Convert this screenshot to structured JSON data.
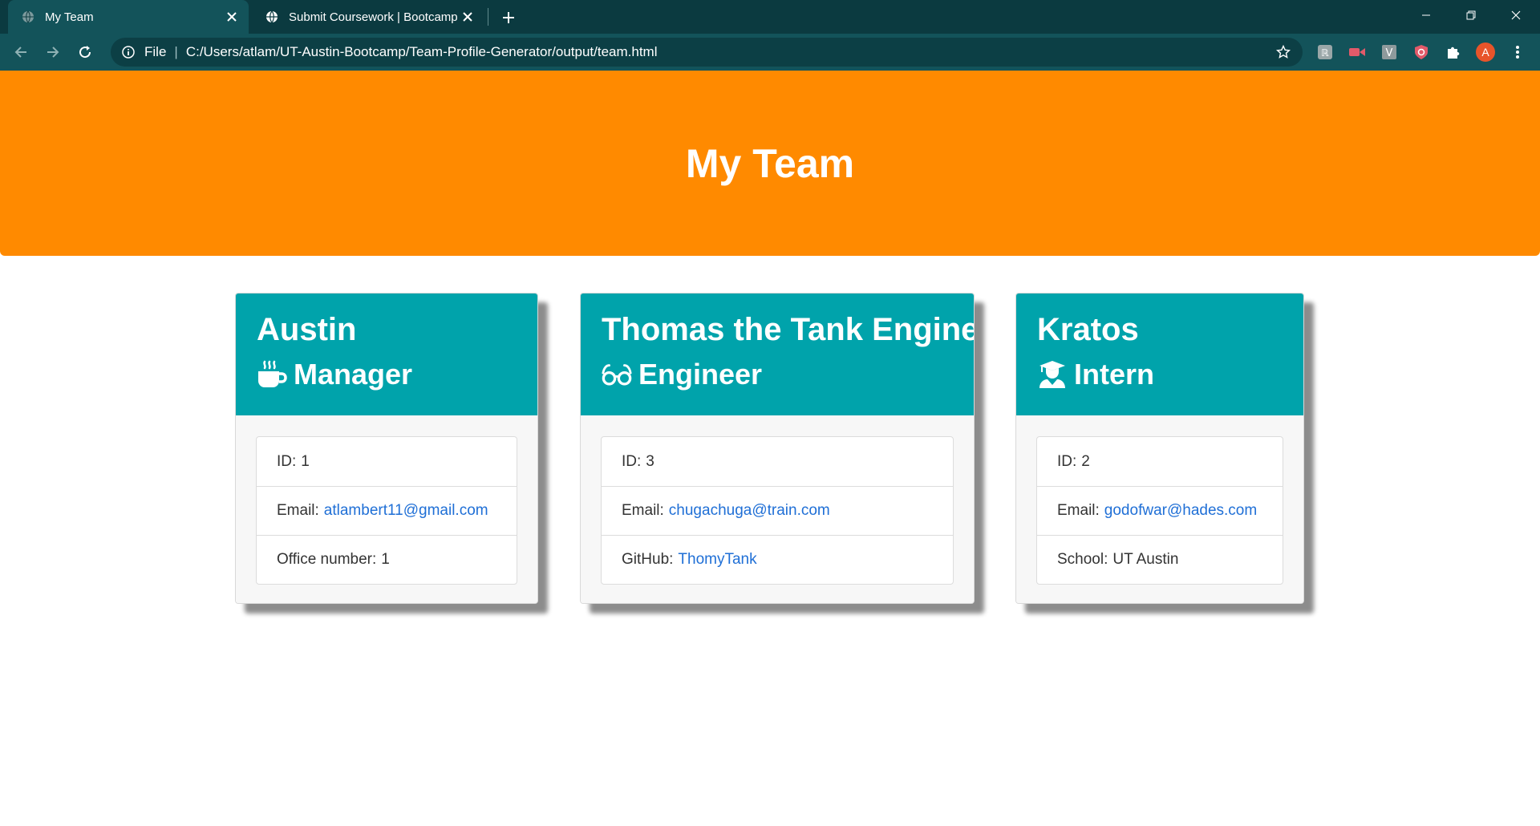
{
  "browser": {
    "tabs": [
      {
        "title": "My Team",
        "active": true
      },
      {
        "title": "Submit Coursework | Bootcamp S",
        "active": false
      }
    ],
    "omnibox": {
      "scheme": "File",
      "url": "C:/Users/atlam/UT-Austin-Bootcamp/Team-Profile-Generator/output/team.html"
    },
    "profile_initial": "A"
  },
  "page": {
    "title": "My Team"
  },
  "team": [
    {
      "name": "Austin",
      "role": "Manager",
      "role_icon": "mug-hot-icon",
      "items": [
        {
          "label": "ID:",
          "value": "1"
        },
        {
          "label": "Email:",
          "link": "atlambert11@gmail.com"
        },
        {
          "label": "Office number:",
          "value": "1"
        }
      ]
    },
    {
      "name": "Thomas the Tank Engine",
      "role": "Engineer",
      "role_icon": "glasses-icon",
      "items": [
        {
          "label": "ID:",
          "value": "3"
        },
        {
          "label": "Email:",
          "link": "chugachuga@train.com"
        },
        {
          "label": "GitHub:",
          "link": "ThomyTank"
        }
      ]
    },
    {
      "name": "Kratos",
      "role": "Intern",
      "role_icon": "user-graduate-icon",
      "items": [
        {
          "label": "ID:",
          "value": "2"
        },
        {
          "label": "Email:",
          "link": "godofwar@hades.com"
        },
        {
          "label": "School:",
          "value": "UT Austin"
        }
      ]
    }
  ],
  "colors": {
    "header_orange": "#ff8a00",
    "card_teal": "#00a3ab",
    "link_blue": "#1f6fd6",
    "chrome_dark": "#0b3a40",
    "chrome_toolbar": "#13535a"
  }
}
